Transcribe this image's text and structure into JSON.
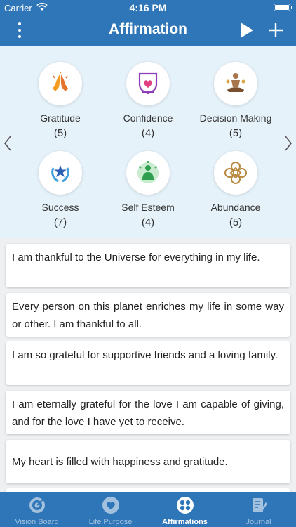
{
  "status_bar": {
    "carrier": "Carrier",
    "time": "4:16 PM"
  },
  "header": {
    "title": "Affirmation"
  },
  "categories": [
    {
      "name": "Gratitude",
      "count": "(5)",
      "icon": "praying-hands-icon"
    },
    {
      "name": "Confidence",
      "count": "(4)",
      "icon": "shield-heart-icon"
    },
    {
      "name": "Decision Making",
      "count": "(5)",
      "icon": "meditating-person-icon"
    },
    {
      "name": "Success",
      "count": "(7)",
      "icon": "laurel-star-icon"
    },
    {
      "name": "Self Esteem",
      "count": "(4)",
      "icon": "glowing-person-icon"
    },
    {
      "name": "Abundance",
      "count": "(5)",
      "icon": "knot-icon"
    }
  ],
  "affirmations": [
    "I am thankful to the Universe for everything in my life.",
    "Every person on this planet enriches my life in some way or other. I am thankful to all.",
    "I am so grateful for supportive friends and a loving family.",
    "I am eternally grateful for the love I am capable of giving, and for the love I have yet to receive.",
    "My heart is filled with happiness and gratitude."
  ],
  "tabs": [
    {
      "label": "Vision Board",
      "icon": "target-icon",
      "active": false
    },
    {
      "label": "Life Purpose",
      "icon": "heart-icon",
      "active": false
    },
    {
      "label": "Affirmations",
      "icon": "affirmation-wheel-icon",
      "active": true
    },
    {
      "label": "Journal",
      "icon": "journal-icon",
      "active": false
    }
  ],
  "colors": {
    "primary": "#2f76b8",
    "category_background": "#e6f2fa",
    "page_background": "#eef0f2"
  }
}
